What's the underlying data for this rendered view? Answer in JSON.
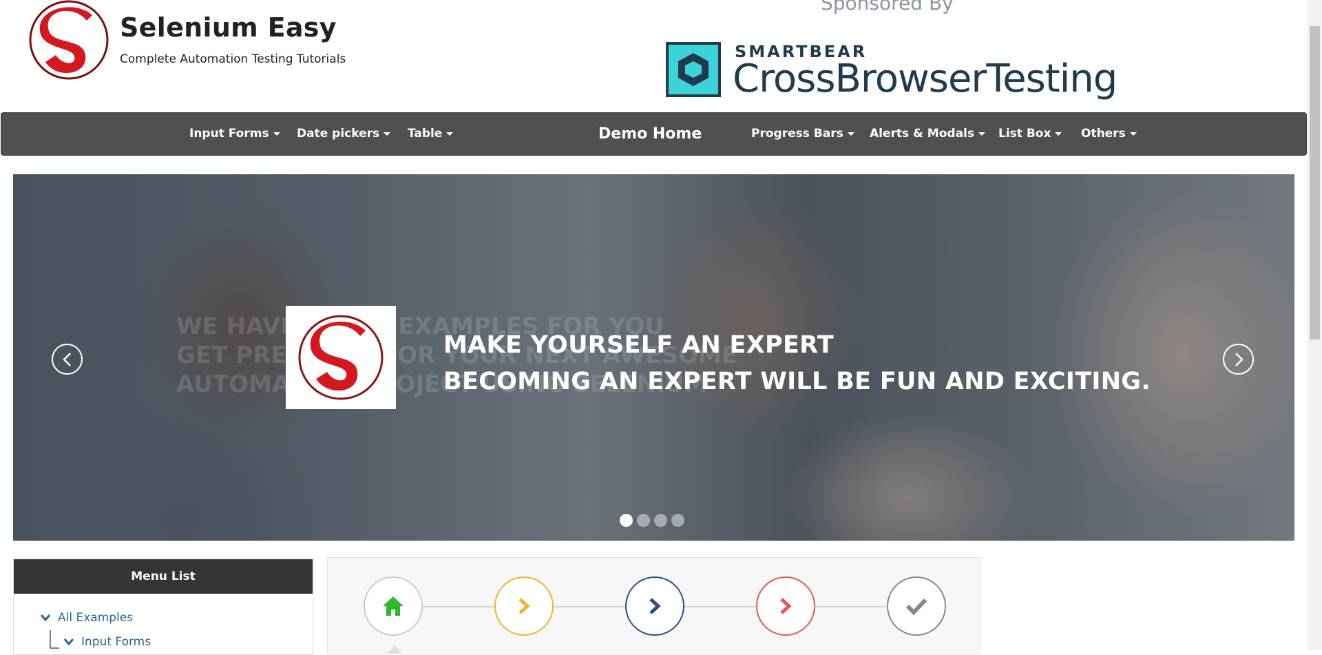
{
  "header": {
    "brand_title": "Selenium Easy",
    "brand_subtitle": "Complete Automation Testing Tutorials",
    "sponsor_label": "Sponsored By",
    "sponsor_company": "SMARTBEAR",
    "sponsor_product": "CrossBrowserTesting"
  },
  "nav": {
    "items": [
      {
        "label": "Input Forms"
      },
      {
        "label": "Date pickers"
      },
      {
        "label": "Table"
      },
      {
        "label": "Demo Home"
      },
      {
        "label": "Progress Bars"
      },
      {
        "label": "Alerts & Modals"
      },
      {
        "label": "List Box"
      },
      {
        "label": "Others"
      }
    ]
  },
  "carousel": {
    "ghost_lines": [
      "WE HAVE GREAT EXAMPLES FOR YOU",
      "GET PREPARED FOR YOUR NEXT AWESOME",
      "AUTOMATION PROJECT USING SELENIUM"
    ],
    "headline_line1": "MAKE YOURSELF AN EXPERT",
    "headline_line2": "BECOMING AN EXPERT WILL BE FUN AND EXCITING.",
    "slide_count": 4,
    "active_slide": 1
  },
  "sidebar": {
    "title": "Menu List",
    "items": [
      {
        "label": "All Examples"
      },
      {
        "label": "Input Forms"
      }
    ]
  },
  "steps": {
    "colors": [
      "#2db82d",
      "#f0b429",
      "#2b4c8c",
      "#e8574f",
      "#888888"
    ],
    "icons": [
      "home-icon",
      "chevron-right-icon",
      "chevron-right-icon",
      "chevron-right-icon",
      "check-icon"
    ]
  }
}
